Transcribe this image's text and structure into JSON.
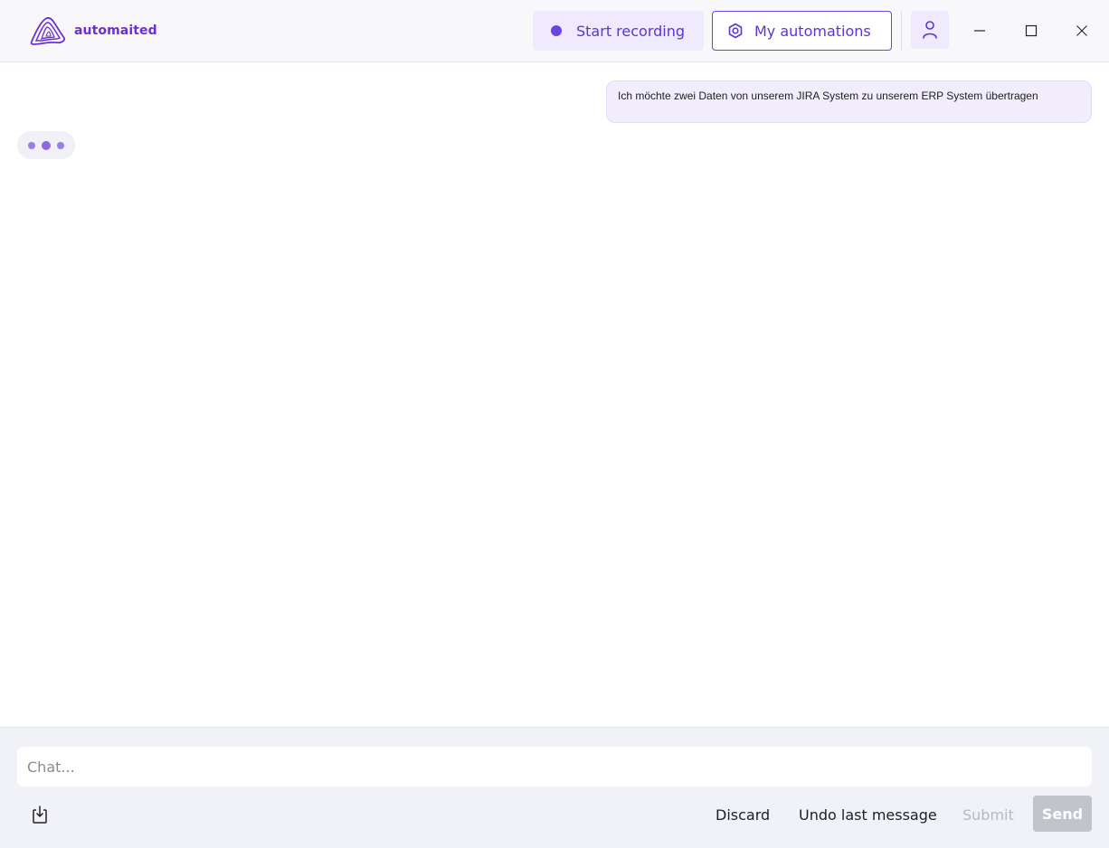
{
  "app": {
    "name": "automaited",
    "brand_color": "#6a2fd6",
    "accent_color": "#6a45e0",
    "logo_icon": "wave-layers-logo"
  },
  "header": {
    "start_recording_label": "Start recording",
    "start_recording_icon": "record-dot-icon",
    "my_automations_label": "My automations",
    "my_automations_icon": "hexagon-gear-icon",
    "user_icon": "user-icon",
    "window_controls": [
      "minimize-icon",
      "maximize-icon",
      "close-icon"
    ]
  },
  "chat": {
    "messages": [
      {
        "role": "user",
        "text": "Ich möchte zwei Daten von unserem JIRA System zu unserem ERP System übertragen"
      }
    ],
    "assistant_status": "typing"
  },
  "footer": {
    "input_placeholder": "Chat...",
    "input_value": "",
    "download_icon": "download-tray-icon",
    "discard_label": "Discard",
    "undo_label": "Undo last message",
    "submit_label": "Submit",
    "send_label": "Send"
  }
}
